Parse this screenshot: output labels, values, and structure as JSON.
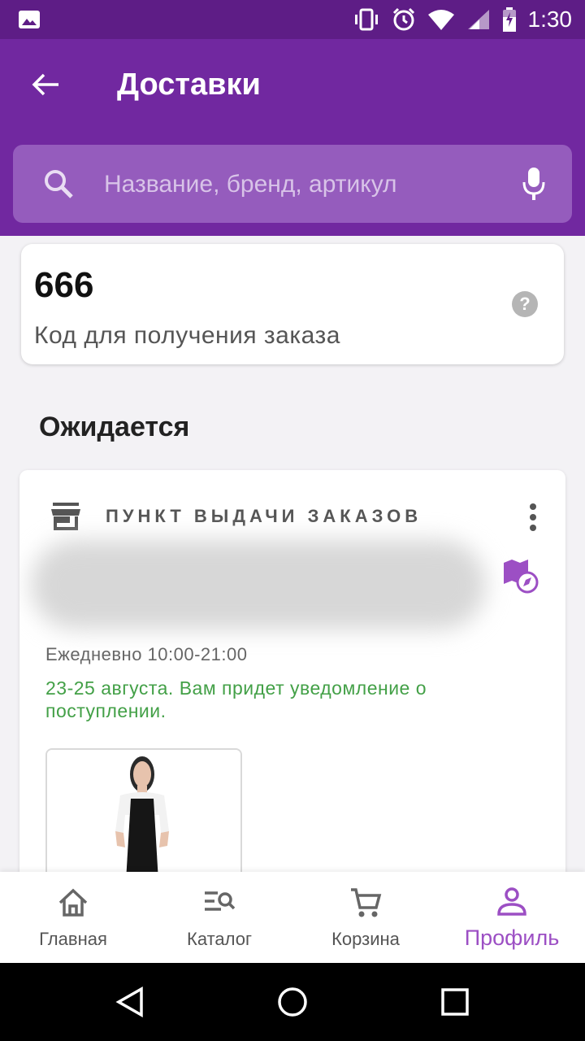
{
  "statusbar": {
    "time": "1:30"
  },
  "header": {
    "title": "Доставки"
  },
  "search": {
    "placeholder": "Название, бренд, артикул"
  },
  "pickup_code": {
    "code": "666",
    "label": "Код для получения заказа"
  },
  "section": {
    "title": "Ожидается"
  },
  "delivery": {
    "type_label": "ПУНКТ ВЫДАЧИ ЗАКАЗОВ",
    "hours": "Ежедневно 10:00-21:00",
    "eta": "23-25 августа. Вам придет уведомление о поступлении."
  },
  "nav": {
    "items": [
      {
        "label": "Главная"
      },
      {
        "label": "Каталог"
      },
      {
        "label": "Корзина"
      },
      {
        "label": "Профиль"
      }
    ]
  },
  "colors": {
    "brand": "#7128a0",
    "accent": "#9c4fc4",
    "eta_green": "#43a047"
  }
}
